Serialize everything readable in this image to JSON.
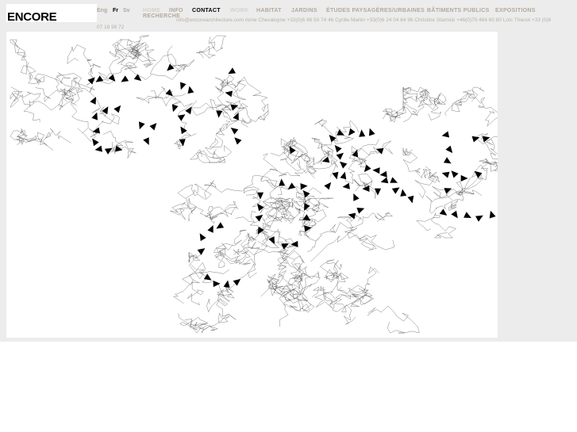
{
  "brand": {
    "logo_text": "ENCORE"
  },
  "languages": [
    {
      "label": "Eng",
      "active": false
    },
    {
      "label": "Fr",
      "active": true
    },
    {
      "label": "Sv",
      "active": false
    }
  ],
  "nav": {
    "row1": [
      "HOME",
      "INFO",
      "CONTACT",
      "WORK",
      "HABITAT",
      "JARDINS",
      "ÉTUDES PAYSAGÈRES/URBAINES",
      "BÂTIMENTS PUBLICS",
      "EXPOSITIONS"
    ],
    "row2": [
      "RECHERCHE"
    ],
    "active": "CONTACT"
  },
  "contact": {
    "line": "info@encorearchitecture.com Anne Chevaluyne +33(0)6 96 50 74 46 Cyrille Martin +33(0)6 24 04 64 96 Christine Starnick +46(0)70 464 60 80 Loïc Thierot +33 (0)6",
    "tail": "07 18 99 72"
  },
  "colors": {
    "band": "#ececec",
    "nav_muted": "#b3a89b",
    "nav_faint": "#d7d0c7",
    "active": "#000000"
  },
  "artwork": {
    "description_icon": "scribble-map-arrows-icon"
  }
}
